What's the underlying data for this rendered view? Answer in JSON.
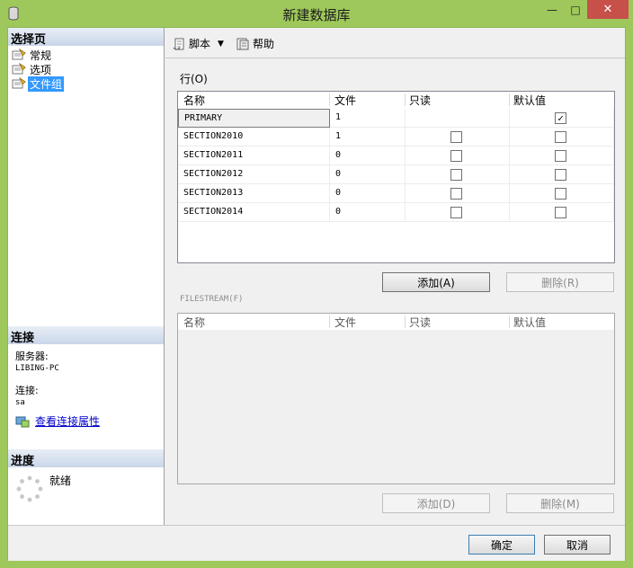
{
  "window": {
    "title": "新建数据库",
    "controls": {
      "minimize": "—",
      "maximize": "□",
      "close": "✕"
    }
  },
  "left_pane": {
    "select_page_header": "选择页",
    "pages": [
      {
        "label": "常规",
        "icon": "page-icon",
        "selected": false
      },
      {
        "label": "选项",
        "icon": "page-icon",
        "selected": false
      },
      {
        "label": "文件组",
        "icon": "page-icon",
        "selected": true
      }
    ],
    "connection_header": "连接",
    "server_label": "服务器:",
    "server_value": "LIBING-PC",
    "connection_label": "连接:",
    "connection_value": "sa",
    "view_connection_link": "查看连接属性",
    "progress_header": "进度",
    "progress_status": "就绪"
  },
  "toolbar": {
    "script_label": "脚本",
    "help_label": "帮助"
  },
  "rows_group": {
    "label": "行(O)",
    "columns": [
      "名称",
      "文件",
      "只读",
      "默认值"
    ],
    "rows": [
      {
        "name": "PRIMARY",
        "files": "1",
        "readonly": null,
        "default": true
      },
      {
        "name": "SECTION2010",
        "files": "1",
        "readonly": false,
        "default": false
      },
      {
        "name": "SECTION2011",
        "files": "0",
        "readonly": false,
        "default": false
      },
      {
        "name": "SECTION2012",
        "files": "0",
        "readonly": false,
        "default": false
      },
      {
        "name": "SECTION2013",
        "files": "0",
        "readonly": false,
        "default": false
      },
      {
        "name": "SECTION2014",
        "files": "0",
        "readonly": false,
        "default": false
      }
    ],
    "add_button": "添加(A)",
    "remove_button": "删除(R)"
  },
  "filestream_group": {
    "label": "FILESTREAM(F)",
    "columns": [
      "名称",
      "文件",
      "只读",
      "默认值"
    ],
    "add_button": "添加(D)",
    "remove_button": "删除(M)"
  },
  "footer": {
    "ok_button": "确定",
    "cancel_button": "取消"
  }
}
